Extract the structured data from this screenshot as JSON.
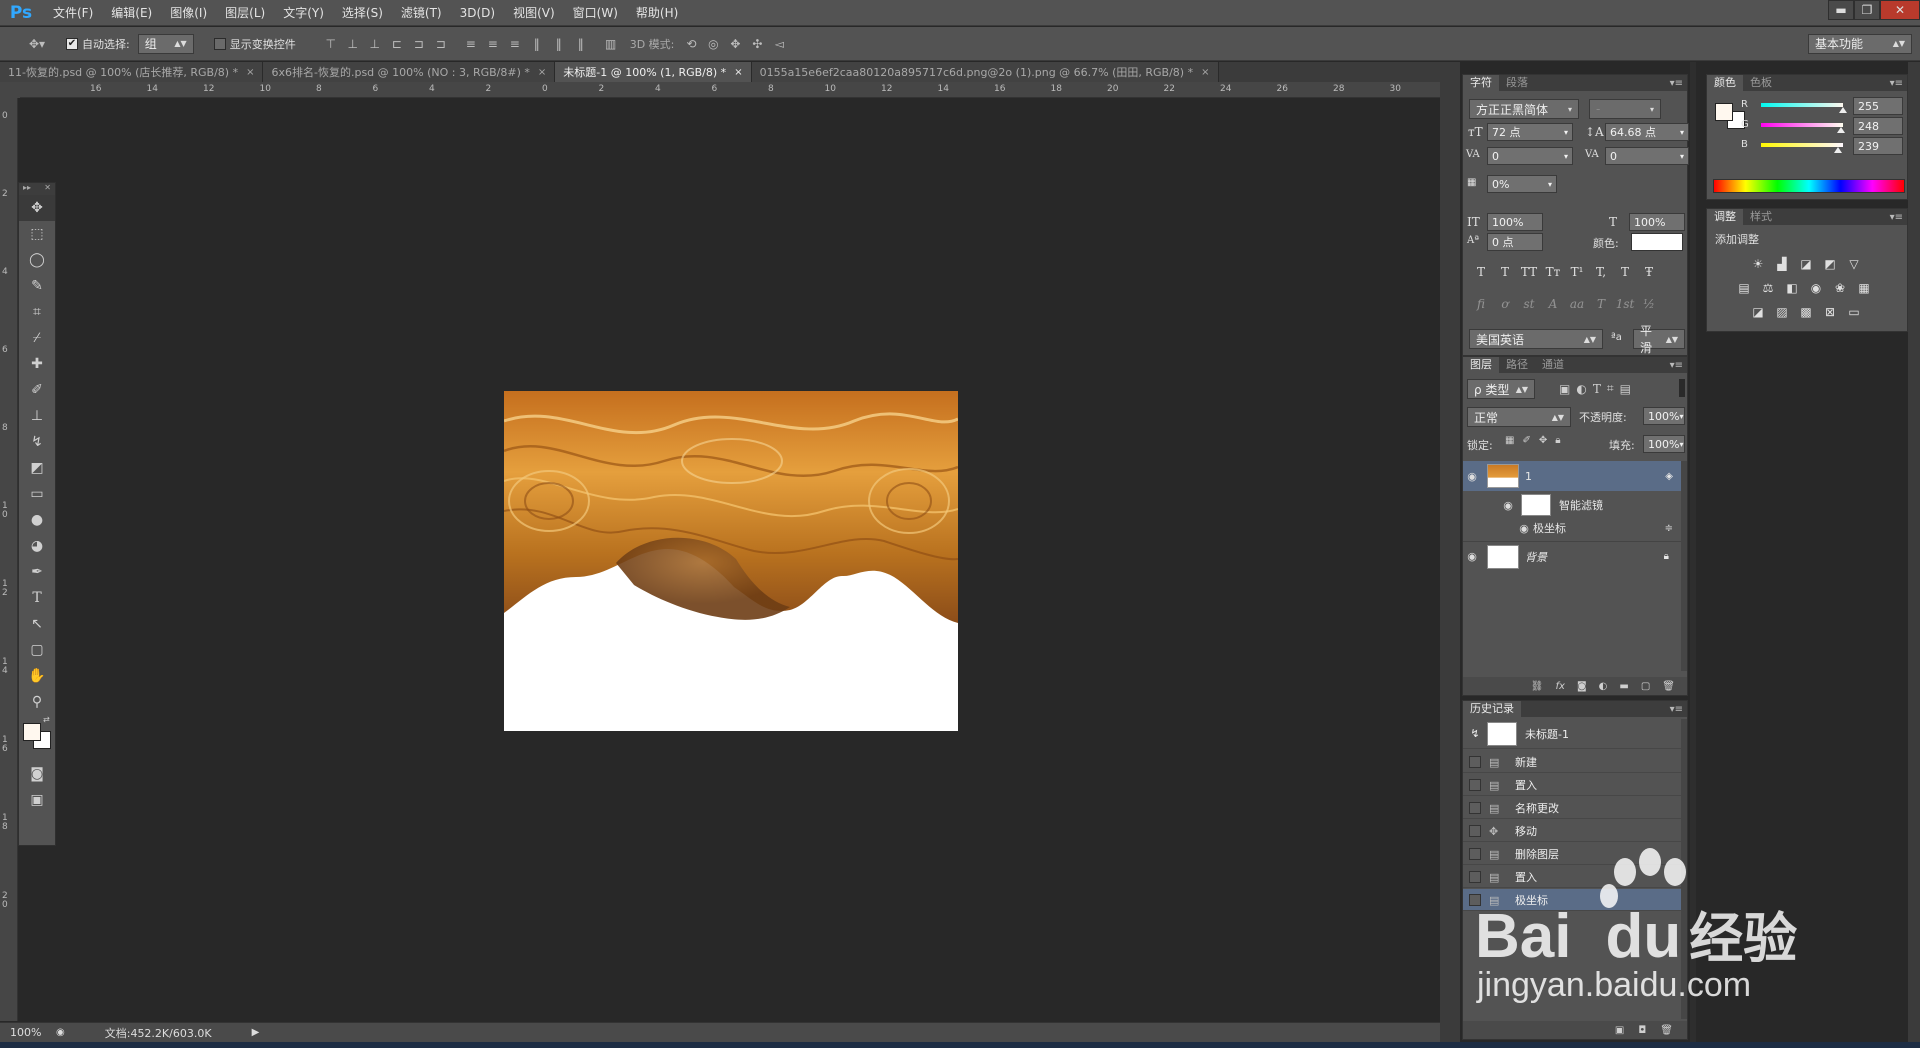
{
  "app": {
    "logo": "Ps"
  },
  "menubar": {
    "items": [
      "文件(F)",
      "编辑(E)",
      "图像(I)",
      "图层(L)",
      "文字(Y)",
      "选择(S)",
      "滤镜(T)",
      "3D(D)",
      "视图(V)",
      "窗口(W)",
      "帮助(H)"
    ],
    "window_controls": {
      "minimize": "▬",
      "restore": "❐",
      "close": "✕"
    }
  },
  "options": {
    "auto_select_label": "自动选择:",
    "auto_select_checked": "✔",
    "auto_select_value": "组",
    "show_transform_label": "显示变换控件",
    "mode_3d_label": "3D 模式:",
    "workspace": "基本功能"
  },
  "tabs": [
    {
      "label": "11-恢复的.psd @ 100% (店长推荐, RGB/8) *",
      "close": "×"
    },
    {
      "label": "6x6排名-恢复的.psd @ 100% (NO : 3, RGB/8#) *",
      "close": "×"
    },
    {
      "label": "未标题-1 @ 100% (1, RGB/8) *",
      "close": "×"
    },
    {
      "label": "0155a15e6ef2caa80120a895717c6d.png@2o (1).png @ 66.7% (田田, RGB/8) *",
      "close": "×"
    }
  ],
  "ruler": {
    "h_labels": [
      "16",
      "14",
      "12",
      "10",
      "8",
      "6",
      "4",
      "2",
      "0",
      "2",
      "4",
      "6",
      "8",
      "10",
      "12",
      "14",
      "16",
      "18",
      "20",
      "22",
      "24",
      "26",
      "28",
      "30",
      "32"
    ],
    "v_labels": [
      "0",
      "2",
      "4",
      "6",
      "8",
      "1 0",
      "1 2",
      "1 4",
      "1 6",
      "1 8",
      "2 0"
    ]
  },
  "status": {
    "zoom": "100%",
    "doc_info": "文档:452.2K/603.0K"
  },
  "character_panel": {
    "tabs": [
      "字符",
      "段落"
    ],
    "font_family": "方正正黑简体",
    "font_style": "-",
    "font_size": "72 点",
    "leading": "64.68 点",
    "kerning": "0",
    "tracking": "0",
    "tsume": "0%",
    "vertical_scale": "100%",
    "horizontal_scale": "100%",
    "baseline_shift": "0 点",
    "color_label": "颜色:",
    "language": "美国英语",
    "aa_label": "ªa",
    "antialias": "平滑",
    "style_buttons": [
      "T",
      "T",
      "TT",
      "Tт",
      "T¹",
      "T,",
      "T",
      "Ŧ"
    ],
    "opentype_buttons": [
      "fi",
      "ơ",
      "st",
      "A",
      "aa",
      "T",
      "1st",
      "½"
    ]
  },
  "color_panel": {
    "tabs": [
      "颜色",
      "色板"
    ],
    "channels": [
      {
        "label": "R",
        "value": "255",
        "fraction": 1.0
      },
      {
        "label": "G",
        "value": "248",
        "fraction": 0.97
      },
      {
        "label": "B",
        "value": "239",
        "fraction": 0.94
      }
    ],
    "colors": {
      "foreground": "#fff8ef",
      "background": "#ffffff"
    }
  },
  "adjustments_panel": {
    "tabs": [
      "调整",
      "样式"
    ],
    "title": "添加调整"
  },
  "layers_panel": {
    "tabs": [
      "图层",
      "路径",
      "通道"
    ],
    "filter_kind": "ρ 类型",
    "blend_mode": "正常",
    "opacity_label": "不透明度:",
    "opacity": "100%",
    "lock_label": "锁定:",
    "fill_label": "填充:",
    "fill": "100%",
    "layers": [
      {
        "name": "1",
        "smart_filter": "智能滤镜",
        "filter": "极坐标"
      },
      {
        "name": "背景"
      }
    ]
  },
  "history_panel": {
    "tabs": [
      "历史记录"
    ],
    "snapshot": "未标题-1",
    "items": [
      "新建",
      "置入",
      "名称更改",
      "移动",
      "删除图层",
      "置入",
      "极坐标"
    ]
  },
  "watermark": {
    "brand": "Bai",
    "brand2": "du",
    "text": "经验",
    "url": "jingyan.baidu.com"
  }
}
